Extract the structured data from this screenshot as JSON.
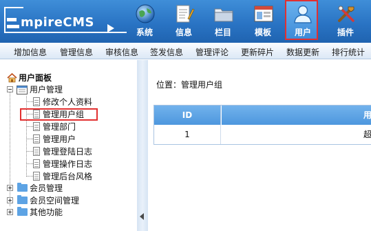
{
  "brand": {
    "logo_text": "mpireCMS"
  },
  "top_nav": [
    {
      "key": "system",
      "label": "系统",
      "icon": "globe-icon"
    },
    {
      "key": "info",
      "label": "信息",
      "icon": "document-pencil-icon"
    },
    {
      "key": "column",
      "label": "栏目",
      "icon": "folder-icon"
    },
    {
      "key": "template",
      "label": "模板",
      "icon": "window-template-icon"
    },
    {
      "key": "user",
      "label": "用户",
      "icon": "user-icon",
      "active": true
    },
    {
      "key": "plugin",
      "label": "插件",
      "icon": "tools-icon"
    }
  ],
  "sub_nav": [
    "增加信息",
    "管理信息",
    "审核信息",
    "签发信息",
    "管理评论",
    "更新碎片",
    "数据更新",
    "排行统计"
  ],
  "sidebar": {
    "title": "用户面板",
    "sections": [
      {
        "label": "用户管理",
        "expanded": true,
        "items": [
          "修改个人资料",
          "管理用户组",
          "管理部门",
          "管理用户",
          "管理登陆日志",
          "管理操作日志",
          "管理后台风格"
        ]
      },
      {
        "label": "会员管理",
        "expanded": false
      },
      {
        "label": "会员空间管理",
        "expanded": false
      },
      {
        "label": "其他功能",
        "expanded": false
      }
    ],
    "selected_item": "管理用户组"
  },
  "content": {
    "breadcrumb": "位置：管理用户组",
    "table": {
      "headers": [
        "ID",
        "用"
      ],
      "rows": [
        [
          "1",
          "超"
        ]
      ]
    }
  },
  "colors": {
    "header_bg": "#2a74c4",
    "highlight_border": "#e23030",
    "table_header_bg": "#5ea5e6"
  }
}
